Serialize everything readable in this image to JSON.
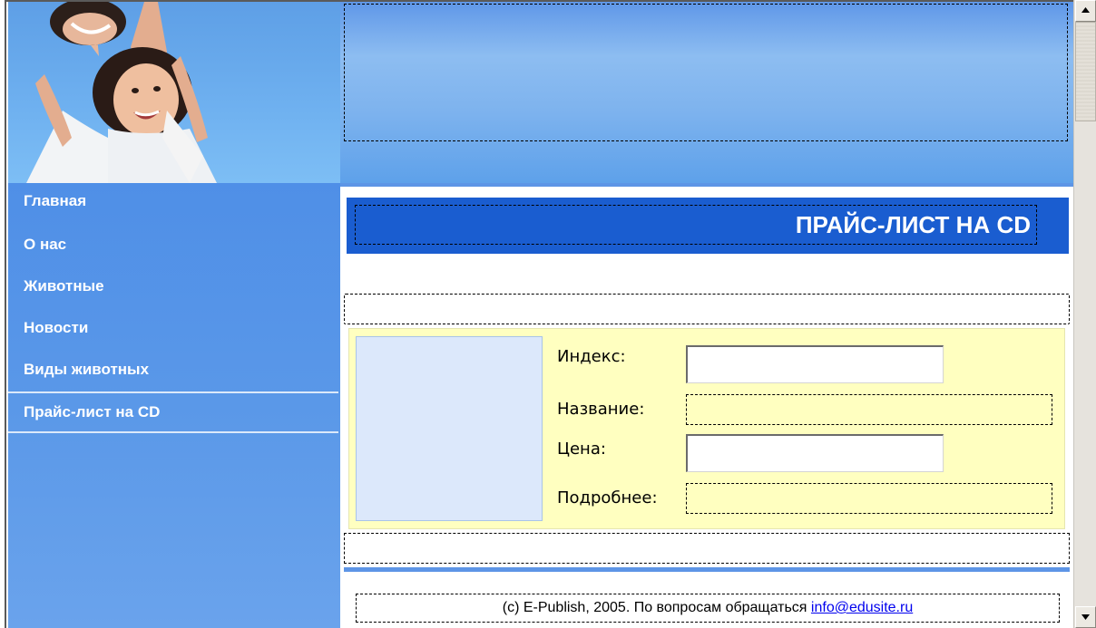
{
  "nav": {
    "items": [
      {
        "label": "Главная"
      },
      {
        "label": "О нас"
      },
      {
        "label": "Животные"
      },
      {
        "label": "Новости"
      },
      {
        "label": "Виды животных"
      },
      {
        "label": "Прайс-лист на CD"
      }
    ],
    "active_index": 5
  },
  "main": {
    "title": "ПРАЙС-ЛИСТ НА CD",
    "fields": {
      "index_label": "Индекс:",
      "index_value": "",
      "name_label": "Название:",
      "price_label": "Цена:",
      "price_value": "",
      "details_label": "Подробнее:"
    }
  },
  "footer": {
    "text": "(c) E-Publish, 2005. По вопросам обращаться ",
    "email": "info@edusite.ru"
  },
  "colors": {
    "nav_bg": "#5a98e8",
    "title_bar": "#1a5dd0",
    "panel_bg": "#ffffc0",
    "image_placeholder": "#dce8fb",
    "accent_rule": "#5d95e6"
  },
  "icons": {
    "scroll_up": "scroll-up-arrow-icon",
    "scroll_down": "scroll-down-arrow-icon"
  }
}
